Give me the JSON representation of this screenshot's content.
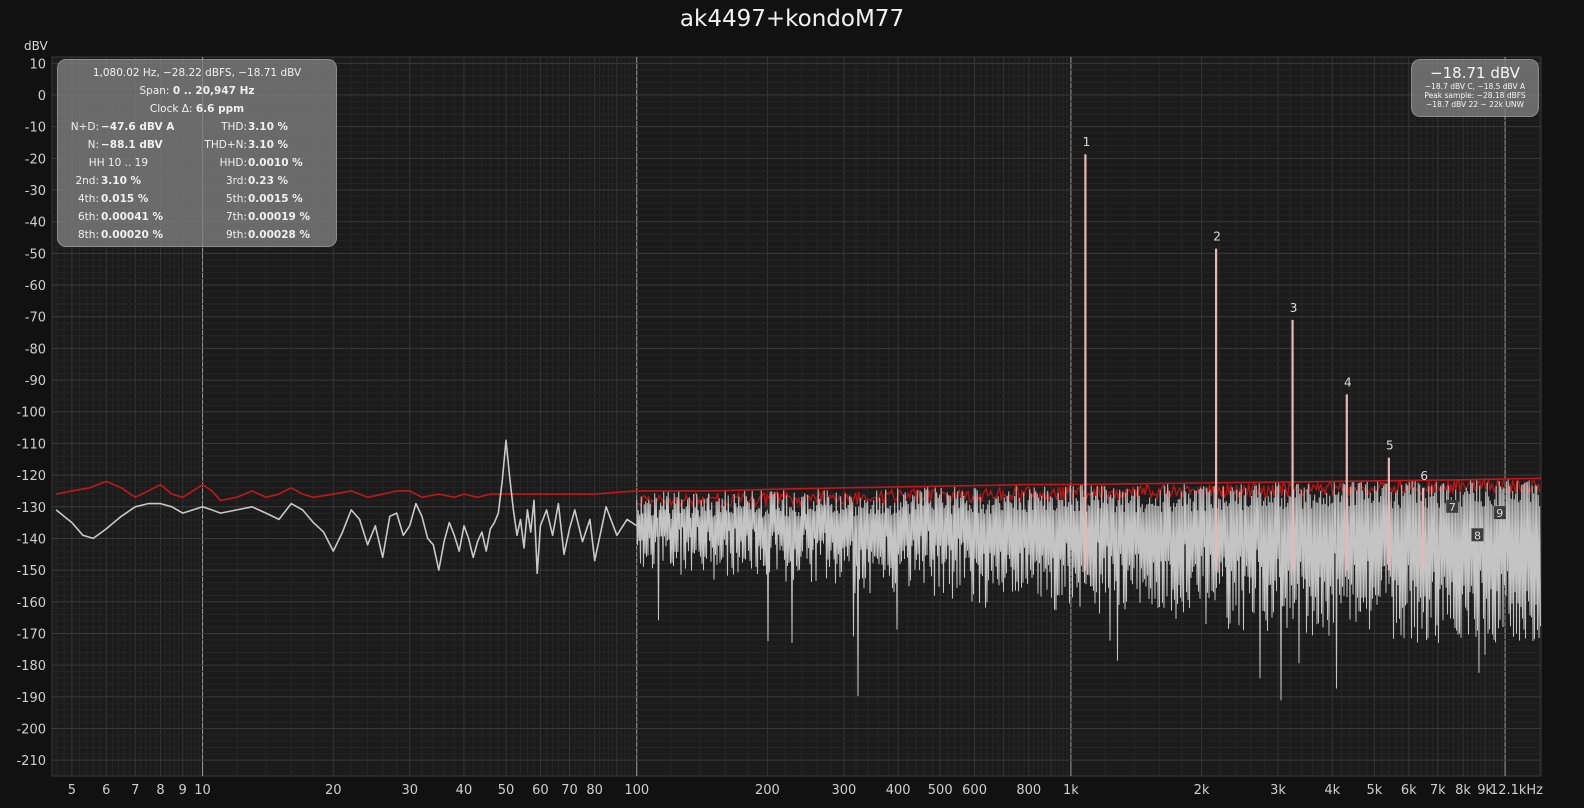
{
  "title": "ak4497+kondoM77",
  "stats": {
    "cursor": "1,080.02 Hz, −28.22 dBFS, −18.71 dBV",
    "span_label": "Span:",
    "span_value": "0 .. 20,947 Hz",
    "clock_label": "Clock Δ:",
    "clock_value": "6.6 ppm",
    "nd_label": "N+D:",
    "nd_value": "−47.6 dBV A",
    "thd_label": "THD:",
    "thd_value": "3.10 %",
    "n_label": "N:",
    "n_value": "−88.1 dBV",
    "thdn_label": "THD+N:",
    "thdn_value": "3.10 %",
    "hh_label": "HH 10 .. 19",
    "hhd_label": "HHD:",
    "hhd_value": "0.0010 %",
    "harmonics": [
      {
        "l1": "2nd:",
        "v1": "3.10 %",
        "l2": "3rd:",
        "v2": "0.23 %"
      },
      {
        "l1": "4th:",
        "v1": "0.015 %",
        "l2": "5th:",
        "v2": "0.0015 %"
      },
      {
        "l1": "6th:",
        "v1": "0.00041 %",
        "l2": "7th:",
        "v2": "0.00019 %"
      },
      {
        "l1": "8th:",
        "v1": "0.00020 %",
        "l2": "9th:",
        "v2": "0.00028 %"
      }
    ]
  },
  "meter": {
    "value": "−18.71 dBV",
    "line1": "−18.7 dBV C, −18.5 dBV A",
    "line2": "Peak sample: −28.18 dBFS",
    "line3": "−18.7 dBV 22 − 22k UNW"
  },
  "chart_data": {
    "type": "line",
    "title": "ak4497+kondoM77",
    "ylabel": "dBV",
    "xscale": "log",
    "xlim": [
      4.5,
      12100
    ],
    "ylim": [
      -215,
      12
    ],
    "grid": true,
    "x_ticks": [
      {
        "v": 5,
        "label": "5"
      },
      {
        "v": 6,
        "label": "6"
      },
      {
        "v": 7,
        "label": "7"
      },
      {
        "v": 8,
        "label": "8"
      },
      {
        "v": 9,
        "label": "9"
      },
      {
        "v": 10,
        "label": "10"
      },
      {
        "v": 20,
        "label": "20"
      },
      {
        "v": 30,
        "label": "30"
      },
      {
        "v": 40,
        "label": "40"
      },
      {
        "v": 50,
        "label": "50"
      },
      {
        "v": 60,
        "label": "60"
      },
      {
        "v": 70,
        "label": "70"
      },
      {
        "v": 80,
        "label": "80"
      },
      {
        "v": 100,
        "label": "100"
      },
      {
        "v": 200,
        "label": "200"
      },
      {
        "v": 300,
        "label": "300"
      },
      {
        "v": 400,
        "label": "400"
      },
      {
        "v": 500,
        "label": "500"
      },
      {
        "v": 600,
        "label": "600"
      },
      {
        "v": 800,
        "label": "800"
      },
      {
        "v": 1000,
        "label": "1k"
      },
      {
        "v": 2000,
        "label": "2k"
      },
      {
        "v": 3000,
        "label": "3k"
      },
      {
        "v": 4000,
        "label": "4k"
      },
      {
        "v": 5000,
        "label": "5k"
      },
      {
        "v": 6000,
        "label": "6k"
      },
      {
        "v": 7000,
        "label": "7k"
      },
      {
        "v": 8000,
        "label": "8k"
      },
      {
        "v": 9000,
        "label": "9k"
      },
      {
        "v": 12100,
        "label": "12.1kHz"
      }
    ],
    "y_ticks": [
      {
        "v": 10,
        "label": "10"
      },
      {
        "v": 0,
        "label": "0"
      },
      {
        "v": -10,
        "label": "-10"
      },
      {
        "v": -20,
        "label": "-20"
      },
      {
        "v": -30,
        "label": "-30"
      },
      {
        "v": -40,
        "label": "-40"
      },
      {
        "v": -50,
        "label": "-50"
      },
      {
        "v": -60,
        "label": "-60"
      },
      {
        "v": -70,
        "label": "-70"
      },
      {
        "v": -80,
        "label": "-80"
      },
      {
        "v": -90,
        "label": "-90"
      },
      {
        "v": -100,
        "label": "-100"
      },
      {
        "v": -110,
        "label": "-110"
      },
      {
        "v": -120,
        "label": "-120"
      },
      {
        "v": -130,
        "label": "-130"
      },
      {
        "v": -140,
        "label": "-140"
      },
      {
        "v": -150,
        "label": "-150"
      },
      {
        "v": -160,
        "label": "-160"
      },
      {
        "v": -170,
        "label": "-170"
      },
      {
        "v": -180,
        "label": "-180"
      },
      {
        "v": -190,
        "label": "-190"
      },
      {
        "v": -200,
        "label": "-200"
      },
      {
        "v": -210,
        "label": "-210"
      }
    ],
    "peaks": [
      {
        "label": "1",
        "x": 1080,
        "y": -18.7
      },
      {
        "label": "2",
        "x": 2160,
        "y": -48.5
      },
      {
        "label": "3",
        "x": 3240,
        "y": -71
      },
      {
        "label": "4",
        "x": 4320,
        "y": -94.5
      },
      {
        "label": "5",
        "x": 5400,
        "y": -114.5
      },
      {
        "label": "6",
        "x": 6480,
        "y": -124
      }
    ],
    "peak_markers_boxed": [
      {
        "label": "7",
        "x": 7560,
        "y": -130
      },
      {
        "label": "8",
        "x": 8640,
        "y": -139
      },
      {
        "label": "9",
        "x": 9720,
        "y": -132
      }
    ],
    "series": [
      {
        "color": "#c01818",
        "points": [
          [
            4.6,
            -126
          ],
          [
            5,
            -125
          ],
          [
            5.5,
            -124
          ],
          [
            6,
            -122
          ],
          [
            6.5,
            -124
          ],
          [
            7,
            -127
          ],
          [
            7.5,
            -125
          ],
          [
            8,
            -123
          ],
          [
            8.5,
            -126
          ],
          [
            9,
            -127
          ],
          [
            9.5,
            -125
          ],
          [
            10,
            -123
          ],
          [
            10.5,
            -125
          ],
          [
            11,
            -128
          ],
          [
            12,
            -127
          ],
          [
            13,
            -125
          ],
          [
            14,
            -127
          ],
          [
            15,
            -126
          ],
          [
            16,
            -124
          ],
          [
            17,
            -126
          ],
          [
            18,
            -127
          ],
          [
            20,
            -126
          ],
          [
            22,
            -125
          ],
          [
            24,
            -127
          ],
          [
            26,
            -126
          ],
          [
            28,
            -125
          ],
          [
            30,
            -125
          ],
          [
            32,
            -127
          ],
          [
            35,
            -126
          ],
          [
            38,
            -127
          ],
          [
            40,
            -126
          ],
          [
            43,
            -127
          ],
          [
            46,
            -126
          ],
          [
            50,
            -126
          ],
          [
            55,
            -126
          ],
          [
            60,
            -126
          ],
          [
            70,
            -126
          ],
          [
            80,
            -126
          ],
          [
            100,
            -125
          ],
          [
            150,
            -125
          ],
          [
            200,
            -124.5
          ],
          [
            300,
            -124
          ],
          [
            500,
            -123.5
          ],
          [
            800,
            -123
          ],
          [
            1000,
            -123
          ],
          [
            2000,
            -122.5
          ],
          [
            4000,
            -122
          ],
          [
            8000,
            -121.5
          ],
          [
            12100,
            -121
          ]
        ]
      },
      {
        "color": "#c8c8c8",
        "points": [
          [
            4.6,
            -131
          ],
          [
            5,
            -135
          ],
          [
            5.3,
            -139
          ],
          [
            5.6,
            -140
          ],
          [
            6,
            -137
          ],
          [
            6.5,
            -133
          ],
          [
            7,
            -130
          ],
          [
            7.5,
            -129
          ],
          [
            8,
            -129
          ],
          [
            8.5,
            -130
          ],
          [
            9,
            -132
          ],
          [
            9.5,
            -131
          ],
          [
            10,
            -130
          ],
          [
            10.5,
            -131
          ],
          [
            11,
            -132
          ],
          [
            12,
            -131
          ],
          [
            13,
            -130
          ],
          [
            14,
            -132
          ],
          [
            15,
            -134
          ],
          [
            16,
            -129
          ],
          [
            17,
            -131
          ],
          [
            18,
            -135
          ],
          [
            19,
            -138
          ],
          [
            20,
            -144
          ],
          [
            21,
            -138
          ],
          [
            22,
            -131
          ],
          [
            23,
            -134
          ],
          [
            24,
            -142
          ],
          [
            25,
            -136
          ],
          [
            26,
            -146
          ],
          [
            27,
            -133
          ],
          [
            28,
            -132
          ],
          [
            29,
            -139
          ],
          [
            30,
            -136
          ],
          [
            31,
            -129
          ],
          [
            32,
            -133
          ],
          [
            33,
            -140
          ],
          [
            34,
            -142
          ],
          [
            35,
            -150
          ],
          [
            36,
            -141
          ],
          [
            37,
            -135
          ],
          [
            38,
            -139
          ],
          [
            39,
            -144
          ],
          [
            40,
            -136
          ],
          [
            41,
            -140
          ],
          [
            42,
            -146
          ],
          [
            43,
            -141
          ],
          [
            44,
            -138
          ],
          [
            45,
            -144
          ],
          [
            46,
            -137
          ],
          [
            47,
            -135
          ],
          [
            48,
            -132
          ],
          [
            49,
            -122
          ],
          [
            50,
            -109
          ],
          [
            51,
            -121
          ],
          [
            52,
            -131
          ],
          [
            53,
            -139
          ],
          [
            54,
            -134
          ],
          [
            55,
            -143
          ],
          [
            56,
            -131
          ],
          [
            57,
            -138
          ],
          [
            58,
            -128
          ],
          [
            59,
            -151
          ],
          [
            60,
            -136
          ],
          [
            62,
            -131
          ],
          [
            64,
            -139
          ],
          [
            66,
            -129
          ],
          [
            68,
            -145
          ],
          [
            70,
            -137
          ],
          [
            72,
            -131
          ],
          [
            75,
            -141
          ],
          [
            78,
            -134
          ],
          [
            80,
            -147
          ],
          [
            85,
            -130
          ],
          [
            90,
            -139
          ],
          [
            95,
            -134
          ],
          [
            100,
            -136
          ]
        ]
      }
    ]
  }
}
